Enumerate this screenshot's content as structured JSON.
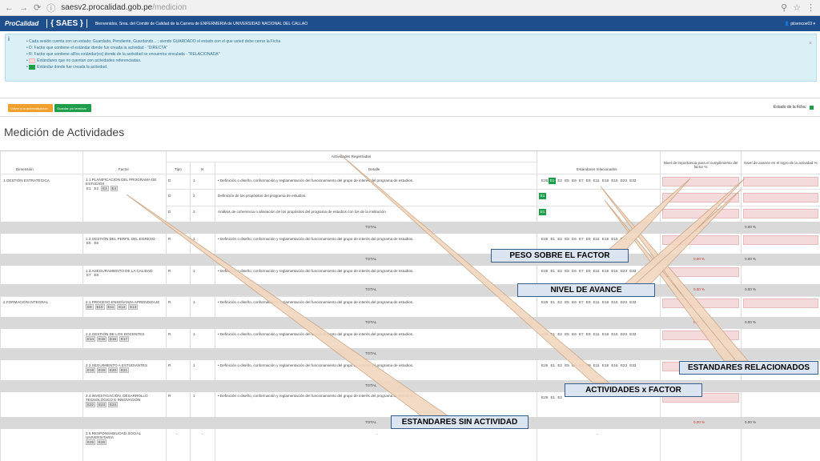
{
  "browser": {
    "url_host": "saesv2.procalidad.gob.pe",
    "url_path": "/medicion"
  },
  "topbar": {
    "brand": "ProCalidad",
    "app": "{ SAES }",
    "welcome": "Bienvenidos, Srea. del Comité de Calidad de la Carrera de ENFERMERIA de UNIVERSIDAD NACIONAL DEL CALLAO",
    "user": "piisencoe03"
  },
  "info": {
    "icon": "i",
    "lines": [
      "Cada sesión cuenta con un estado: Guardado, Pendiente, Guardando... ; siendo GUARDADO el estado con el que usted debe cerrar la Ficha",
      "D: Factor que contiene el estándar donde fue creada la actividad - \"DIRECTA\"",
      "R: Factor que contiene al/los estándar(es) donde de la actividad se encuentra vinculada - \"RELACIONADA\"",
      "Estándares que no cuentan con actividades referenciadas.",
      "Estándar donde fue creada la actividad."
    ]
  },
  "actions": {
    "btn1": "Volver a la autoevaluación",
    "btn2": "Guardar y/o terminar",
    "estado": "Estado de la ficha:"
  },
  "title": "Medición de Actividades",
  "table": {
    "headers": {
      "dimension": "Dimensión",
      "factor": "Factor",
      "group": "Actividades Registradas",
      "tipo": "Tipo",
      "n": "N",
      "detalle": "Detalle",
      "estandares": "Estándares relacionados",
      "importancia": "Nivel de importancia para el cumplimiento del factor %",
      "avance": "Nivel de avance en el logro de la actividad %"
    },
    "total": "TOTAL",
    "dims": [
      "1.GESTIÓN ESTRATÉGICA",
      "2.FORMACIÓN INTEGRAL"
    ],
    "factors": [
      {
        "name": "1.1.PLANIFICACIÓN DEL PROGRAMA DE ESTUDIOS",
        "stds": [
          "E1",
          "E2",
          "E3",
          "E4"
        ]
      },
      {
        "name": "1.2.GESTIÓN DEL PERFIL DEL EGRESO",
        "stds": [
          "E5",
          "E6"
        ]
      },
      {
        "name": "1.3.ASEGURAMIENTO DE LA CALIDAD",
        "stds": [
          "E7",
          "E8"
        ]
      },
      {
        "name": "2.1.PROCESO ENSEÑANZA APRENDIZAJE",
        "stds": [
          "E9",
          "E10",
          "E11",
          "E12",
          "E13"
        ]
      },
      {
        "name": "2.2.GESTIÓN DE LOS DOCENTES",
        "stds": [
          "E14",
          "E15",
          "E16",
          "E17"
        ]
      },
      {
        "name": "2.3.SEGUIMIENTO A ESTUDIANTES",
        "stds": [
          "E18",
          "E19",
          "E20",
          "E21"
        ]
      },
      {
        "name": "2.4.INVESTIGACIÓN, DESARROLLO TECNOLÓGICO E INNOVACIÓN",
        "stds": [
          "E22",
          "E23",
          "E24"
        ]
      },
      {
        "name": "2.5.RESPONSABILIDAD SOCIAL UNIVERSITARIA",
        "stds": [
          "E25",
          "E26"
        ]
      }
    ],
    "rows": [
      {
        "tipo": "D",
        "n": "1",
        "detalle": "• Definición o diseño, conformación y reglamentación del funcionamiento del grupo de interés del programa de estudios.",
        "stds": "E26 E1 E2 E5 E6 E7 E9 E11 E18 E16 E23 E33"
      },
      {
        "tipo": "D",
        "n": "2",
        "detalle": "Definición de los propósitos del programa de estudios.",
        "stds": "E1"
      },
      {
        "tipo": "D",
        "n": "3",
        "detalle": "Análisis de coherencia o alineación de los propósitos del programa de estudios con los de la institución",
        "stds": "E1"
      },
      {
        "tipo": "R",
        "n": "1",
        "detalle": "• Definición o diseño, conformación y reglamentación del funcionamiento del grupo de interés del programa de estudios.",
        "stds": "E26 E1 E2 E5 E6 E7 E9 E11 E18 E16 E23 E33"
      },
      {
        "tipo": "R",
        "n": "1",
        "detalle": "• Definición o diseño, conformación y reglamentación del funcionamiento del grupo de interés del programa de estudios.",
        "stds": "E26 E1 E2 E5 E6 E7 E9 E11 E18 E16 E23 E33"
      },
      {
        "tipo": "R",
        "n": "1",
        "detalle": "• Definición o diseño, conformación y reglamentación del funcionamiento del grupo de interés del programa de estudios.",
        "stds": "E26 E1 E2 E5 E6 E7 E9 E11 E18 E16 E23 E33"
      },
      {
        "tipo": "R",
        "n": "1",
        "detalle": "• Definición o diseño, conformación y reglamentación del funcionamiento del grupo de interés del programa de estudios.",
        "stds": "E26 E1 E2 E5 E6 E7 E9 E11 E18 E16 E23 E33"
      },
      {
        "tipo": "R",
        "n": "1",
        "detalle": "• Definición o diseño, conformación y reglamentación del funcionamiento del grupo de interés del programa de estudios.",
        "stds": "E26 E1 E2 E5 E6 E7 E9 E11 E18 E16 E23 E33"
      },
      {
        "tipo": "R",
        "n": "1",
        "detalle": "• Definición o diseño, conformación y reglamentación del funcionamiento del grupo de interés del programa de estudios.",
        "stds": "E29 E1 E2"
      },
      {
        "tipo": "-",
        "n": "-",
        "detalle": "-",
        "stds": "-"
      }
    ],
    "pcts": {
      "imp": "0.00 %",
      "av": "0.00 %"
    }
  },
  "callouts": {
    "peso": "PESO SOBRE EL FACTOR",
    "avance": "NIVEL DE AVANCE",
    "estandares": "ESTANDARES RELACIONADOS",
    "actividades": "ACTIVIDADES x FACTOR",
    "sin": "ESTANDARES SIN ACTIVIDAD"
  },
  "colors": {
    "accent": "#1f4e8c",
    "green": "#1e9e4a",
    "orange": "#f0a02c",
    "callout_fill": "#dbe5f1",
    "arrow_fill": "#f2d6bf"
  }
}
